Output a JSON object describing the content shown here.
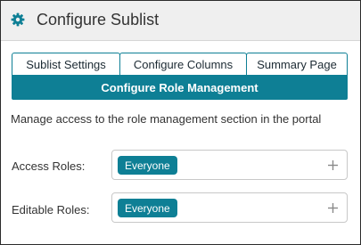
{
  "header": {
    "title": "Configure Sublist",
    "icon": "gear-icon"
  },
  "tabs": [
    {
      "label": "Sublist Settings"
    },
    {
      "label": "Configure Columns"
    },
    {
      "label": "Summary Page"
    }
  ],
  "active_tab": {
    "label": "Configure Role Management"
  },
  "description": "Manage access to the role management section in the portal",
  "fields": {
    "access_roles": {
      "label": "Access Roles:",
      "chip": "Everyone"
    },
    "editable_roles": {
      "label": "Editable Roles:",
      "chip": "Everyone"
    }
  },
  "colors": {
    "accent": "#0e7f95",
    "header_bg": "#efefef"
  }
}
